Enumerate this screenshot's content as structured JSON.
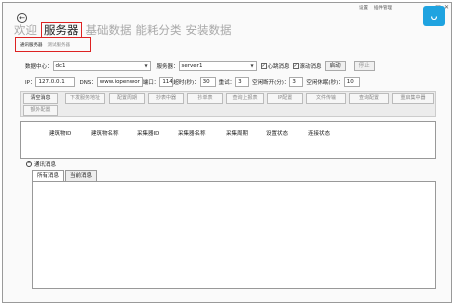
{
  "window": {
    "links": [
      "设置",
      "插件管理"
    ],
    "min": "—",
    "restore": "□",
    "close": "✕",
    "logo_glyph": "ᴗ"
  },
  "back_glyph": "←",
  "nav": {
    "items": [
      "欢迎",
      "服务器",
      "基础数据",
      "能耗分类",
      "安装数据"
    ],
    "active": "服务器"
  },
  "subtabs": [
    "通讯服务器",
    "测试服务器"
  ],
  "form": {
    "datacenter_label": "数据中心：",
    "datacenter_value": "dc1",
    "server_label": "服务器：",
    "server_value": "server1",
    "heartbeat_label": "心跳消息",
    "heartbeat_checked": true,
    "scroll_label": "滚动消息",
    "scroll_checked": true,
    "start_button": "启动",
    "stop_button": "停止",
    "ip_label": "IP：",
    "ip_value": "127.0.0.1",
    "dns_label": "DNS：",
    "dns_value": "www.iopenwor",
    "port_label": "端口：",
    "port_value": "1146",
    "timeout_label": "超时(秒)：",
    "timeout_value": "30",
    "retry_label": "重试：",
    "retry_value": "3",
    "idle_disconnect_label": "空闲断开(分)：",
    "idle_disconnect_value": "3",
    "idle_sleep_label": "空闲休眠(秒)：",
    "idle_sleep_value": "10"
  },
  "commands": {
    "row1": [
      "清空消息",
      "下发服务地址",
      "配置周期",
      "抄表中器",
      "抄单表",
      "查询上报表",
      "IP配置",
      "文件传输",
      "查询配置",
      "重启集中器"
    ],
    "row2": [
      "额外配置"
    ]
  },
  "grid": {
    "columns": [
      "建筑物ID",
      "建筑物名称",
      "采集器ID",
      "采集器名称",
      "采集周期",
      "设置状态",
      "连接状态"
    ]
  },
  "messages": {
    "section_label": "通讯消息",
    "collapse_glyph": "^",
    "tabs": [
      "所有消息",
      "当前消息"
    ]
  }
}
